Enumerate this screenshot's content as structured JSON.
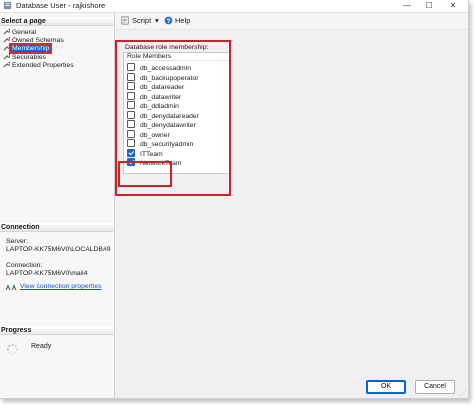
{
  "window": {
    "title": "Database User - rajkishore",
    "controls": {
      "minimize": "—",
      "maximize": "☐",
      "close": "✕"
    }
  },
  "left_panel": {
    "select_page_header": "Select a page",
    "pages": [
      {
        "label": "General",
        "icon": "wrench-icon",
        "selected": false
      },
      {
        "label": "Owned Schemas",
        "icon": "wrench-icon",
        "selected": false
      },
      {
        "label": "Membership",
        "icon": "wrench-icon",
        "selected": true
      },
      {
        "label": "Securables",
        "icon": "wrench-icon",
        "selected": false
      },
      {
        "label": "Extended Properties",
        "icon": "wrench-icon",
        "selected": false
      }
    ],
    "connection_header": "Connection",
    "server_label": "Server:",
    "server_value": "LAPTOP-KK75M6V0\\LOCALDB#9",
    "connection_label": "Connection:",
    "connection_value": "LAPTOP-KK75M6V0\\mail4",
    "view_connection_link": "View connection properties",
    "progress_header": "Progress",
    "progress_status": "Ready"
  },
  "toolbar": {
    "script_label": "Script",
    "script_dropdown": "▾",
    "help_label": "Help"
  },
  "membership": {
    "group_label": "Database role membership:",
    "column_header": "Role Members",
    "roles": [
      {
        "name": "db_accessadmin",
        "checked": false
      },
      {
        "name": "db_backupoperator",
        "checked": false
      },
      {
        "name": "db_datareader",
        "checked": false
      },
      {
        "name": "db_datawriter",
        "checked": false
      },
      {
        "name": "db_ddladmin",
        "checked": false
      },
      {
        "name": "db_denydatareader",
        "checked": false
      },
      {
        "name": "db_denydatawriter",
        "checked": false
      },
      {
        "name": "db_owner",
        "checked": false
      },
      {
        "name": "db_securityadmin",
        "checked": false
      },
      {
        "name": "ITTeam",
        "checked": true
      },
      {
        "name": "NetworkTeam",
        "checked": true
      }
    ]
  },
  "buttons": {
    "ok": "OK",
    "cancel": "Cancel"
  },
  "colors": {
    "selection_blue": "#0a64d8",
    "highlight_red": "#d21f26",
    "checkbox_blue": "#1f63d8",
    "link_blue": "#1a4fd6"
  }
}
